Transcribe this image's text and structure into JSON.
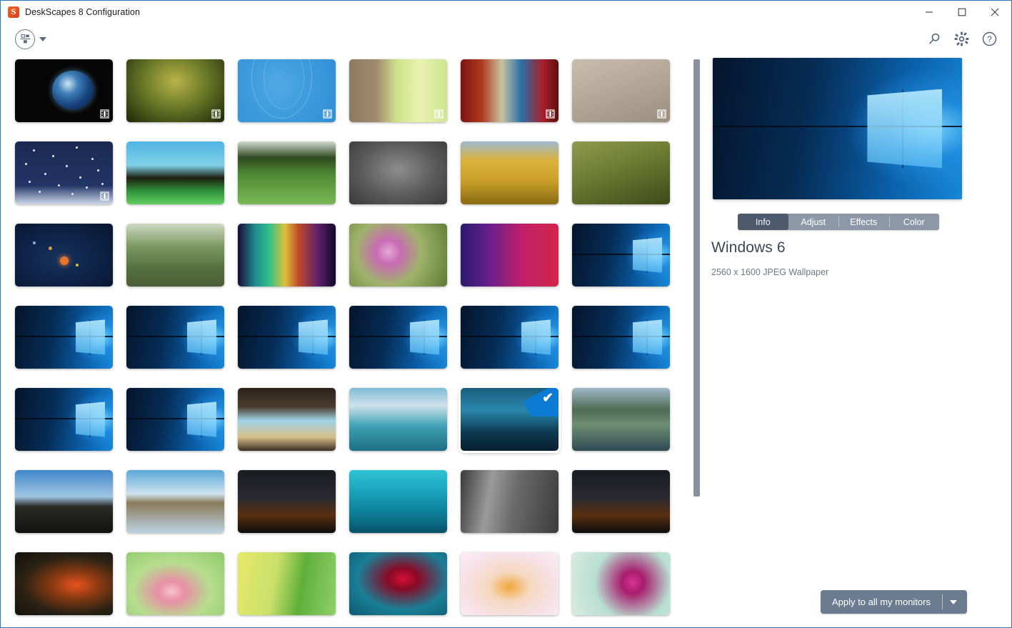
{
  "window": {
    "title": "DeskScapes 8 Configuration",
    "logo_icon": "stardock-logo-icon",
    "controls": [
      {
        "name": "minimize-button",
        "icon": "minimize-icon"
      },
      {
        "name": "maximize-button",
        "icon": "maximize-icon"
      },
      {
        "name": "close-button",
        "icon": "close-icon"
      }
    ]
  },
  "toolbar": {
    "view_mode_button": {
      "name": "view-mode-button",
      "icon": "layout-grid-icon"
    },
    "view_mode_caret": {
      "name": "view-mode-dropdown-caret",
      "icon": "chevron-down-icon"
    },
    "actions": [
      {
        "name": "search-button",
        "icon": "search-icon",
        "label": "Search"
      },
      {
        "name": "settings-button",
        "icon": "gear-icon",
        "label": "Settings"
      },
      {
        "name": "help-button",
        "icon": "help-circle-icon",
        "label": "Help"
      }
    ]
  },
  "gallery": {
    "selected_index": 28,
    "scrollbar": {
      "thumb_top_pct": 0,
      "thumb_height_pct": 78
    },
    "thumbnails": [
      {
        "name": "thumb-earth-dream",
        "art": "earth",
        "animated": true
      },
      {
        "name": "thumb-grass-dream",
        "art": "grassdark",
        "animated": true
      },
      {
        "name": "thumb-blue-rings-dream",
        "art": "bluerings",
        "animated": true
      },
      {
        "name": "thumb-tree-bark-dream",
        "art": "barkgreen",
        "animated": true
      },
      {
        "name": "thumb-retro-car-dream",
        "art": "retrocar",
        "animated": true
      },
      {
        "name": "thumb-sand-dream",
        "art": "sand",
        "animated": true
      },
      {
        "name": "thumb-snowfall-dream",
        "art": "snowfall",
        "animated": true
      },
      {
        "name": "thumb-floating-island",
        "art": "island",
        "animated": false
      },
      {
        "name": "thumb-golf-ball",
        "art": "golf",
        "animated": false
      },
      {
        "name": "thumb-cat-mono",
        "art": "catmono",
        "animated": false
      },
      {
        "name": "thumb-wheat-field",
        "art": "wheat",
        "animated": false
      },
      {
        "name": "thumb-grass-seed",
        "art": "grassseed",
        "animated": false
      },
      {
        "name": "thumb-solar-system",
        "art": "solar",
        "animated": false
      },
      {
        "name": "thumb-tree-lane",
        "art": "treelane",
        "animated": false
      },
      {
        "name": "thumb-aurora",
        "art": "aurora",
        "animated": false
      },
      {
        "name": "thumb-pink-daisy",
        "art": "pinkdaisy",
        "animated": false
      },
      {
        "name": "thumb-waveform",
        "art": "waveform",
        "animated": false
      },
      {
        "name": "thumb-windows-hero-1",
        "art": "w10",
        "animated": false
      },
      {
        "name": "thumb-windows-hero-2",
        "art": "w10",
        "animated": false
      },
      {
        "name": "thumb-windows-hero-3",
        "art": "w10",
        "animated": false
      },
      {
        "name": "thumb-windows-hero-4",
        "art": "w10",
        "animated": false
      },
      {
        "name": "thumb-windows-hero-5",
        "art": "w10",
        "animated": false
      },
      {
        "name": "thumb-windows-hero-6",
        "art": "w10",
        "animated": false
      },
      {
        "name": "thumb-windows-hero-7",
        "art": "w10",
        "animated": false
      },
      {
        "name": "thumb-windows-hero-8",
        "art": "w10",
        "animated": false
      },
      {
        "name": "thumb-windows-hero-9",
        "art": "w10",
        "animated": false
      },
      {
        "name": "thumb-sea-cave-arch",
        "art": "seacave",
        "animated": false
      },
      {
        "name": "thumb-lagoon-boat",
        "art": "lagoon",
        "animated": false
      },
      {
        "name": "thumb-ice-cave",
        "art": "icecave",
        "animated": false
      },
      {
        "name": "thumb-fjord-lake",
        "art": "fjord",
        "animated": false
      },
      {
        "name": "thumb-arctic-ridge",
        "art": "arctic",
        "animated": false
      },
      {
        "name": "thumb-sea-stack-beach",
        "art": "seastack",
        "animated": false
      },
      {
        "name": "thumb-night-tent-1",
        "art": "nighttent",
        "animated": false
      },
      {
        "name": "thumb-underwater-diver",
        "art": "underwater",
        "animated": false
      },
      {
        "name": "thumb-granite-cliff",
        "art": "granite",
        "animated": false
      },
      {
        "name": "thumb-night-tent-2",
        "art": "nighttent",
        "animated": false
      },
      {
        "name": "thumb-red-tulips",
        "art": "tulips",
        "animated": false
      },
      {
        "name": "thumb-pink-blossom",
        "art": "blossom",
        "animated": false
      },
      {
        "name": "thumb-green-fern",
        "art": "fern",
        "animated": false
      },
      {
        "name": "thumb-red-cactus-flower",
        "art": "cactusflower",
        "animated": false
      },
      {
        "name": "thumb-orange-daisy",
        "art": "orangedaisy",
        "animated": false
      },
      {
        "name": "thumb-magenta-flower",
        "art": "magenta",
        "animated": false
      }
    ]
  },
  "details": {
    "preview_name": "preview-windows-hero",
    "tabs": [
      {
        "label": "Info",
        "active": true
      },
      {
        "label": "Adjust",
        "active": false
      },
      {
        "label": "Effects",
        "active": false
      },
      {
        "label": "Color",
        "active": false
      }
    ],
    "title": "Windows 6",
    "meta": "2560 x 1600 JPEG Wallpaper"
  },
  "footer": {
    "apply_label": "Apply to all my monitors",
    "apply_caret_icon": "chevron-down-icon"
  },
  "colors": {
    "window_border": "#2a7ab8",
    "accent_blue": "#0b7bd4",
    "tab_bar": "#8c98a8",
    "tab_active": "#4d5a6b",
    "button": "#6b7c91",
    "scrollbar": "#8791a0",
    "title_text": "#3b4654",
    "meta_text": "#6d7785"
  }
}
